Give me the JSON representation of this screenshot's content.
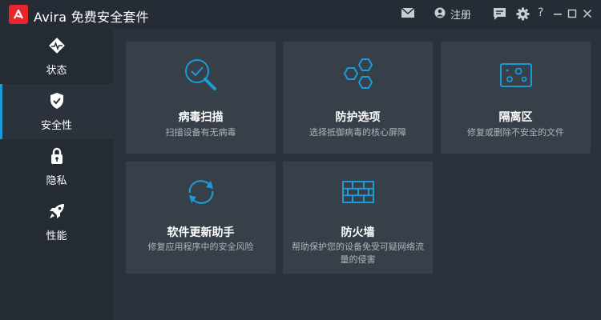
{
  "app": {
    "title": "Avira 免费安全套件"
  },
  "titlebar": {
    "register_label": "注册",
    "help_label": "?",
    "icons": [
      "mail-icon",
      "user-icon",
      "feedback-icon",
      "gear-icon",
      "minimize-icon",
      "maximize-icon",
      "close-icon"
    ]
  },
  "sidebar": {
    "items": [
      {
        "label": "状态",
        "icon": "pulse-icon",
        "active": false
      },
      {
        "label": "安全性",
        "icon": "shield-icon",
        "active": true
      },
      {
        "label": "隐私",
        "icon": "lock-icon",
        "active": false
      },
      {
        "label": "性能",
        "icon": "rocket-icon",
        "active": false
      }
    ]
  },
  "cards": [
    {
      "title": "病毒扫描",
      "desc": "扫描设备有无病毒",
      "icon": "magnifier-check-icon"
    },
    {
      "title": "防护选项",
      "desc": "选择抵御病毒的核心屏障",
      "icon": "hexagons-icon"
    },
    {
      "title": "隔离区",
      "desc": "修复或删除不安全的文件",
      "icon": "quarantine-icon"
    },
    {
      "title": "软件更新助手",
      "desc": "修复应用程序中的安全风险",
      "icon": "refresh-icon"
    },
    {
      "title": "防火墙",
      "desc": "帮助保护您的设备免受可疑网络流量的侵害",
      "icon": "firewall-icon"
    }
  ],
  "colors": {
    "accent": "#1a9bd8",
    "brand_red": "#e8262d",
    "card_bg": "#373f49",
    "sidebar_bg": "#252b33"
  }
}
